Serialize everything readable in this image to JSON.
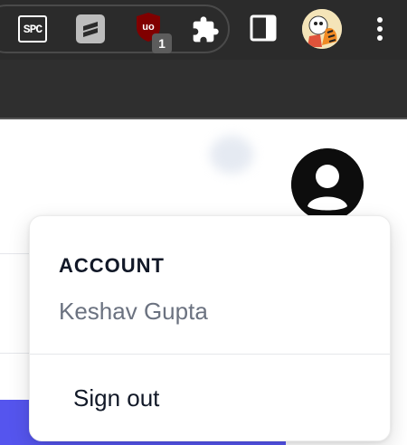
{
  "browser_toolbar": {
    "extensions": {
      "spc_label": "SPC",
      "ublock_badge_count": "1",
      "icons": [
        "spc-icon",
        "stripe-icon",
        "ublock-origin-icon",
        "puzzle-extensions-icon",
        "side-panel-icon",
        "profile-avatar-icon",
        "kebab-menu-icon"
      ]
    }
  },
  "account_menu": {
    "heading": "ACCOUNT",
    "user_name": "Keshav Gupta",
    "sign_out_label": "Sign out"
  },
  "colors": {
    "toolbar_bg": "#2b2b2b",
    "menu_heading": "#111827",
    "menu_subtext": "#6b7280",
    "accent": "#5555ee",
    "ublock_red": "#800000"
  }
}
